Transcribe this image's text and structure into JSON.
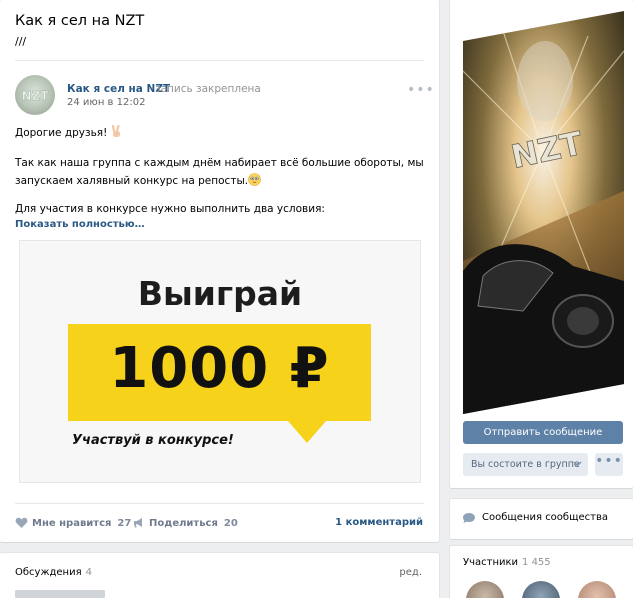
{
  "group": {
    "title": "Как я сел на NZT",
    "status": "///"
  },
  "post": {
    "author": "Как я сел на NZT",
    "pinned_label": "запись закреплена",
    "date": "24 июн в 12:02",
    "more_icon": "ellipsis-icon",
    "line1": "Дорогие друзья!",
    "line2": "Так как наша группа с каждым днём набирает всё большие обороты, мы",
    "line3": "запускаем халявный конкурс на репосты.",
    "line4": "Для участия в конкурсе нужно выполнить два условия:",
    "show_more": "Показать полностью…",
    "promo": {
      "heading": "Выиграй",
      "amount": "1000 ₽",
      "cta": "Участвуй в конкурсе!",
      "accent_color": "#f7d21a"
    },
    "actions": {
      "like_label": "Мне нравится",
      "like_count": "27",
      "share_label": "Поделиться",
      "share_count": "20",
      "comments": "1 комментарий"
    }
  },
  "discussions": {
    "title": "Обсуждения",
    "count": "4",
    "edit": "ред."
  },
  "sidebar": {
    "cover_text": "NZT",
    "send_message": "Отправить сообщение",
    "membership": "Вы состоите в группе",
    "more_icon": "ellipsis-icon",
    "messages_label": "Сообщения сообщества",
    "members_title": "Участники",
    "members_count": "1 455"
  },
  "colors": {
    "link": "#2a5885",
    "button_primary": "#5e81a8",
    "button_secondary": "#e5ebf1",
    "page_bg": "#edeef0"
  }
}
